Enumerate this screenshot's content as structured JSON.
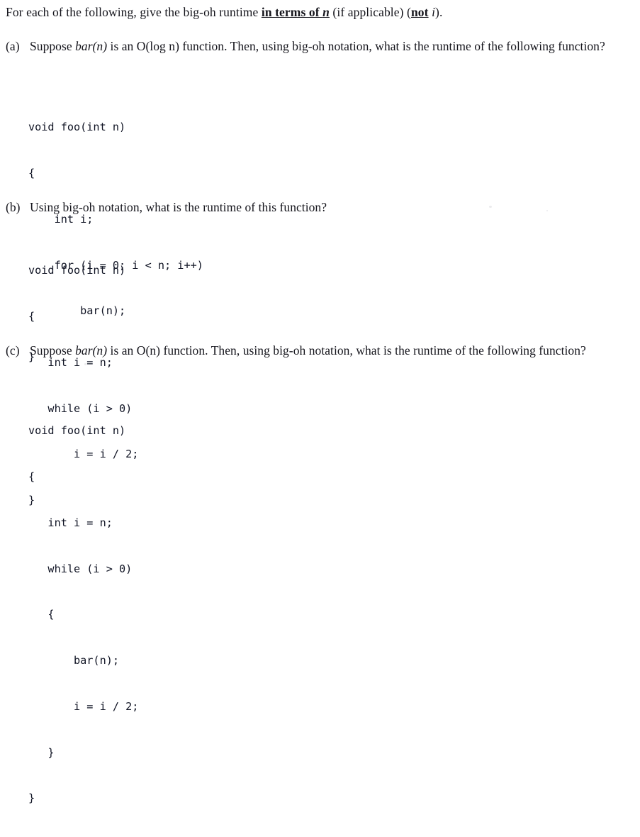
{
  "document": {
    "type": "scanned-worksheet",
    "background_color": "#ffffff",
    "text_color": "#15151c",
    "code_color": "#101424"
  },
  "intro": {
    "part1": "For each of the following, give the big-oh runtime ",
    "emphasis1": "in terms of ",
    "emphasis1_italic": "n",
    "part2": " (if applicable) (",
    "emphasis2": "not",
    "part3": " ",
    "emphasis2_italic": "i",
    "part4": ")."
  },
  "problems": [
    {
      "marker": "(a)",
      "text_pre": "Suppose ",
      "text_italic": "bar(n)",
      "text_post": " is an O(log n) function. Then, using big-oh notation, what is the runtime of the following function?",
      "code": [
        "void foo(int n)",
        "{",
        "    int i;",
        "    for (i = 0; i < n; i++)",
        "        bar(n);",
        "}"
      ]
    },
    {
      "marker": "(b)",
      "text_pre": "Using big-oh notation, what is the runtime of this function?",
      "text_italic": "",
      "text_post": "",
      "code": [
        "void foo(int n)",
        "{",
        "   int i = n;",
        "   while (i > 0)",
        "       i = i / 2;",
        "}"
      ]
    },
    {
      "marker": "(c)",
      "text_pre": "Suppose ",
      "text_italic": "bar(n)",
      "text_post": " is an O(n) function. Then, using big-oh notation, what is the runtime of the following function?",
      "code": [
        "void foo(int n)",
        "{",
        "   int i = n;",
        "   while (i > 0)",
        "   {",
        "       bar(n);",
        "       i = i / 2;",
        "   }",
        "}"
      ]
    }
  ]
}
